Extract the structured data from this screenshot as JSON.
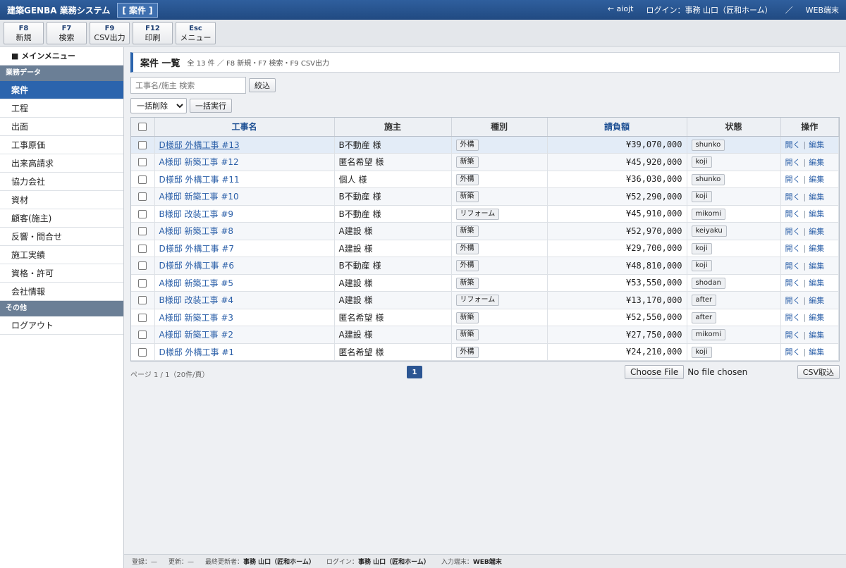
{
  "titlebar": {
    "app_name": "建築GENBA 業務システム",
    "screen_label": "[ 案件 ]",
    "user_link": "← aiojt",
    "login_info": "ログイン：事務 山口（匠和ホーム）",
    "divider": "／",
    "terminal": "WEB端末"
  },
  "fkeys": [
    {
      "key": "F8",
      "label": "新規"
    },
    {
      "key": "F7",
      "label": "検索"
    },
    {
      "key": "F9",
      "label": "CSV出力"
    },
    {
      "key": "F12",
      "label": "印刷"
    },
    {
      "key": "Esc",
      "label": "メニュー"
    }
  ],
  "sidebar": {
    "main_menu": "■ メインメニュー",
    "section_business": "業務データ",
    "items_business": [
      "案件",
      "工程",
      "出面",
      "工事原価",
      "出来高請求",
      "協力会社",
      "資材",
      "顧客(施主)",
      "反響・問合せ",
      "施工実績",
      "資格・許可",
      "会社情報"
    ],
    "section_other": "その他",
    "items_other": [
      "ログアウト"
    ]
  },
  "page": {
    "title": "案件 一覧",
    "subtitle": "全 13 件 ／ F8 新規・F7 検索・F9 CSV出力"
  },
  "search": {
    "placeholder": "工事名/施主 検索",
    "button": "絞込"
  },
  "bulk": {
    "selected": "一括削除",
    "execute": "一括実行"
  },
  "table": {
    "headers": [
      "工事名",
      "施主",
      "種別",
      "請負額",
      "状態",
      "操作"
    ],
    "open_label": "開く",
    "edit_label": "編集",
    "op_sep": "|",
    "rows": [
      {
        "name": "D様邸 外構工事 #13",
        "client": "B不動産 様",
        "type": "外構",
        "amount": "¥39,070,000",
        "status": "shunko"
      },
      {
        "name": "A様邸 新築工事 #12",
        "client": "匿名希望 様",
        "type": "新築",
        "amount": "¥45,920,000",
        "status": "koji"
      },
      {
        "name": "D様邸 外構工事 #11",
        "client": "個人 様",
        "type": "外構",
        "amount": "¥36,030,000",
        "status": "shunko"
      },
      {
        "name": "A様邸 新築工事 #10",
        "client": "B不動産 様",
        "type": "新築",
        "amount": "¥52,290,000",
        "status": "koji"
      },
      {
        "name": "B様邸 改装工事 #9",
        "client": "B不動産 様",
        "type": "リフォーム",
        "amount": "¥45,910,000",
        "status": "mikomi"
      },
      {
        "name": "A様邸 新築工事 #8",
        "client": "A建設 様",
        "type": "新築",
        "amount": "¥52,970,000",
        "status": "keiyaku"
      },
      {
        "name": "D様邸 外構工事 #7",
        "client": "A建設 様",
        "type": "外構",
        "amount": "¥29,700,000",
        "status": "koji"
      },
      {
        "name": "D様邸 外構工事 #6",
        "client": "B不動産 様",
        "type": "外構",
        "amount": "¥48,810,000",
        "status": "koji"
      },
      {
        "name": "A様邸 新築工事 #5",
        "client": "A建設 様",
        "type": "新築",
        "amount": "¥53,550,000",
        "status": "shodan"
      },
      {
        "name": "B様邸 改装工事 #4",
        "client": "A建設 様",
        "type": "リフォーム",
        "amount": "¥13,170,000",
        "status": "after"
      },
      {
        "name": "A様邸 新築工事 #3",
        "client": "匿名希望 様",
        "type": "新築",
        "amount": "¥52,550,000",
        "status": "after"
      },
      {
        "name": "A様邸 新築工事 #2",
        "client": "A建設 様",
        "type": "新築",
        "amount": "¥27,750,000",
        "status": "mikomi"
      },
      {
        "name": "D様邸 外構工事 #1",
        "client": "匿名希望 様",
        "type": "外構",
        "amount": "¥24,210,000",
        "status": "koji"
      }
    ]
  },
  "pager": {
    "info": "ページ 1 / 1（20件/頁）",
    "current": "1",
    "choose_file": "Choose File",
    "no_file": "No file chosen",
    "csv_import": "CSV取込"
  },
  "footer": {
    "registered": "登録：—",
    "updated": "更新：—",
    "last_updater_label": "最終更新者：",
    "last_updater": "事務 山口（匠和ホーム）",
    "login_label": "ログイン：",
    "login_user": "事務 山口（匠和ホーム）",
    "terminal_label": "入力端末：",
    "terminal": "WEB端末"
  }
}
